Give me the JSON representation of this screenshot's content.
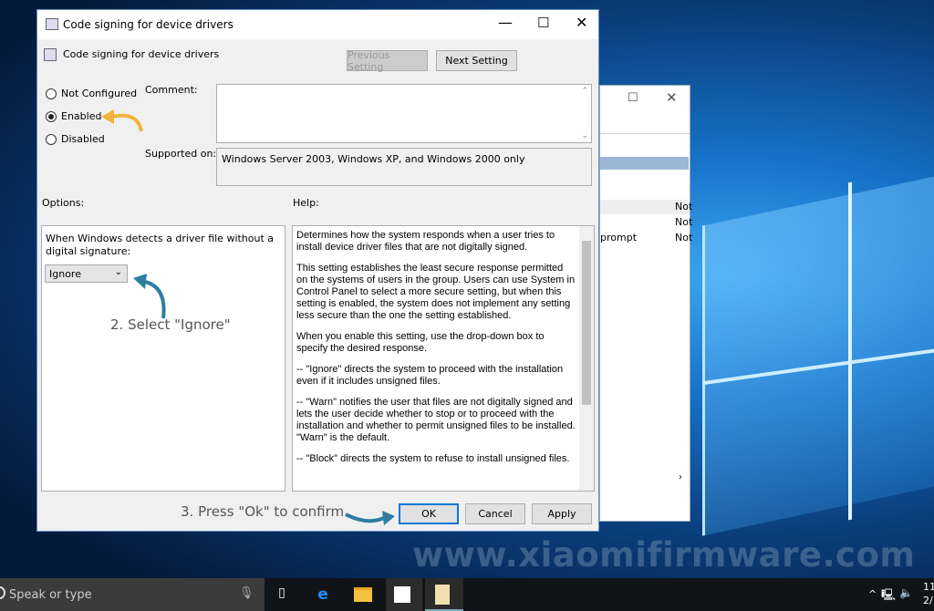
{
  "dialog": {
    "title": "Code signing for device drivers",
    "header": "Code signing for device drivers",
    "previous_label": "Previous Setting",
    "next_label": "Next Setting",
    "radios": [
      {
        "label": "Not Configured",
        "checked": false
      },
      {
        "label": "Enabled",
        "checked": true
      },
      {
        "label": "Disabled",
        "checked": false
      }
    ],
    "comment_label": "Comment:",
    "supported_label": "Supported on:",
    "supported_value": "Windows Server 2003, Windows XP, and Windows 2000 only",
    "options_label": "Options:",
    "help_label": "Help:",
    "option_text": "When Windows detects a driver file without a digital signature:",
    "dropdown_value": "Ignore",
    "help_paragraphs": [
      "Determines how the system responds when a user tries to install device driver files that are not digitally signed.",
      "This setting establishes the least secure response permitted on the systems of users in the group. Users can use System in Control Panel to select a more secure setting, but when this setting is enabled, the system does not implement any setting less secure than the one the setting established.",
      "When you enable this setting, use the drop-down box to specify the desired response.",
      "--   \"Ignore\" directs the system to proceed with the installation even if it includes unsigned files.",
      "--   \"Warn\" notifies the user that files are not digitally signed and lets the user decide whether to stop or to proceed with the installation and whether to permit unsigned files to be installed. \"Warn\" is the default.",
      "--   \"Block\" directs the system to refuse to install unsigned files."
    ],
    "ok_label": "OK",
    "cancel_label": "Cancel",
    "apply_label": "Apply"
  },
  "annotations": {
    "step2": "2. Select \"Ignore\"",
    "step3": "3. Press \"Ok\" to confirm",
    "arrow_color": "#f0b43a",
    "arrow2_color": "#2d7ea0"
  },
  "background_window": {
    "rows": [
      "Not",
      "Not",
      "Not"
    ],
    "row3_prefix": "prompt"
  },
  "watermark": "www.xiaomifirmware.com",
  "taskbar": {
    "search_placeholder": "Speak or type",
    "clock": "11",
    "date": "2/"
  }
}
